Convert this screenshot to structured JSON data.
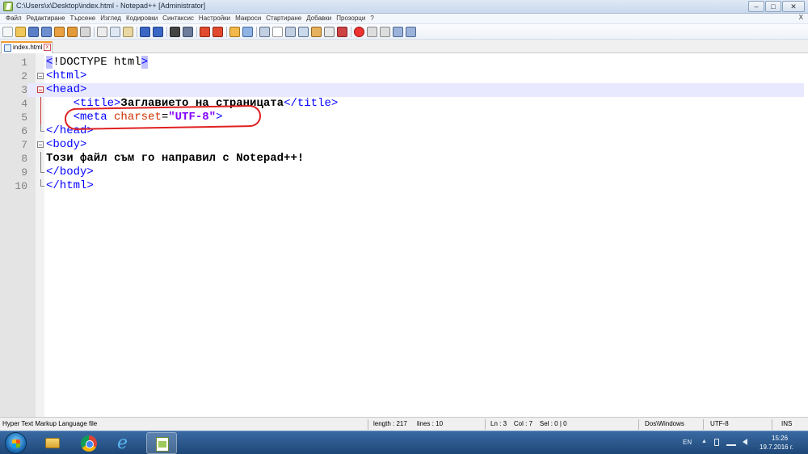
{
  "window": {
    "title": "C:\\Users\\x\\Desktop\\index.html - Notepad++ [Administrator]",
    "minimize": "–",
    "maximize": "□",
    "close": "✕"
  },
  "menu": {
    "items": [
      "Файл",
      "Редактиране",
      "Търсене",
      "Изглед",
      "Кодировки",
      "Синтаксис",
      "Настройки",
      "Макроси",
      "Стартиране",
      "Добавки",
      "Прозорци",
      "?"
    ],
    "close_x": "X"
  },
  "tab": {
    "label": "index.html",
    "close": "x"
  },
  "editor": {
    "line_numbers": [
      "1",
      "2",
      "3",
      "4",
      "5",
      "6",
      "7",
      "8",
      "9",
      "10"
    ],
    "current_line": 3,
    "lines": {
      "l1": {
        "p1": "<",
        "p2": "!DOCTYPE html",
        "p3": ">"
      },
      "l2": "<html>",
      "l3": "<head>",
      "l4": {
        "indent": "    ",
        "open": "<title>",
        "text": "Заглавието на страницата",
        "close": "</title>"
      },
      "l5": {
        "indent": "    ",
        "open": "<meta ",
        "attr": "charset",
        "eq": "=",
        "value": "\"UTF-8\"",
        "close": ">"
      },
      "l6": "</head>",
      "l7": "<body>",
      "l8": "Този файл съм го направил с Notepad++!",
      "l9": "</body>",
      "l10": "</html>"
    }
  },
  "status": {
    "file_type": "Hyper Text Markup Language file",
    "length": "length : 217",
    "lines": "lines : 10",
    "position": "Ln : 3    Col : 7    Sel : 0 | 0",
    "eol": "Dos\\Windows",
    "encoding": "UTF-8",
    "mode": "INS"
  },
  "taskbar": {
    "language": "EN",
    "tray_arrow": "▲",
    "time": "15:26",
    "date": "19.7.2016 г."
  },
  "colors": {
    "tag": "#0000ff",
    "attribute": "#cc3300",
    "string": "#8000ff",
    "annotation": "#e02020",
    "current_line": "#e8e8ff"
  }
}
